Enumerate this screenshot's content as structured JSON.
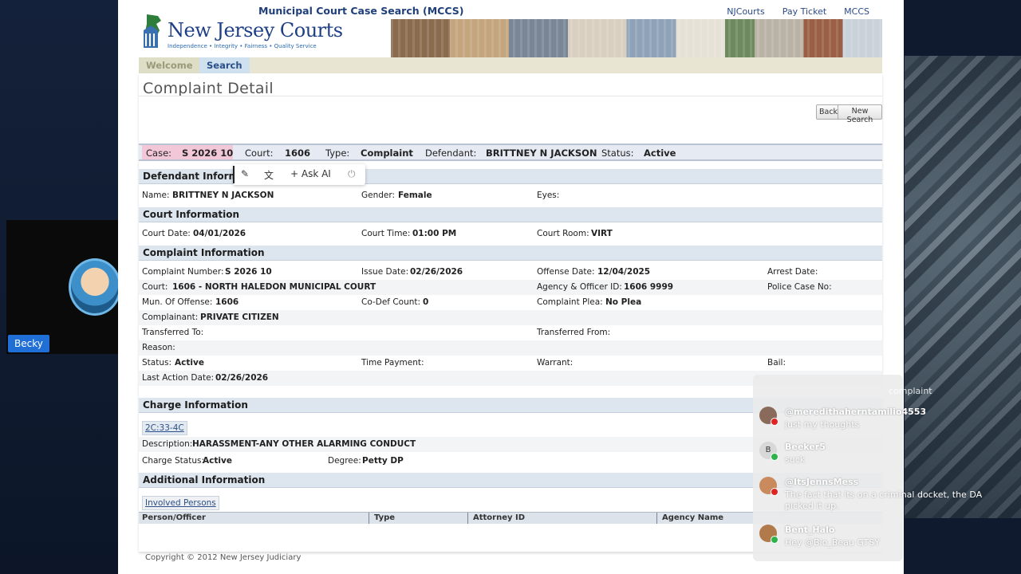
{
  "overlay": {
    "presenter_name": "Becky"
  },
  "header": {
    "title": "Municipal Court Case Search (MCCS)",
    "links": [
      "NJCourts",
      "Pay Ticket",
      "MCCS"
    ],
    "logo_text": "New Jersey Courts",
    "logo_tagline": "Independence • Integrity • Fairness • Quality Service"
  },
  "nav": {
    "welcome": "Welcome",
    "search": "Search"
  },
  "page": {
    "title": "Complaint Detail",
    "back_button": "Back",
    "new_search_button": "New Search"
  },
  "case_bar": {
    "case_label": "Case:",
    "case_value": "S 2026 10",
    "court_label": "Court:",
    "court_value": "1606",
    "type_label": "Type:",
    "type_value": "Complaint",
    "defendant_label": "Defendant:",
    "defendant_value": "BRITTNEY N JACKSON",
    "status_label": "Status:",
    "status_value": "Active"
  },
  "ai_toolbar": {
    "ask_ai": "Ask AI"
  },
  "defendant": {
    "heading": "Defendant Informa",
    "name_label": "Name:",
    "name_value": "BRITTNEY N JACKSON",
    "gender_label": "Gender:",
    "gender_value": "Female",
    "eyes_label": "Eyes:"
  },
  "court": {
    "heading": "Court Information",
    "date_label": "Court Date:",
    "date_value": "04/01/2026",
    "time_label": "Court Time:",
    "time_value": "01:00 PM",
    "room_label": "Court Room:",
    "room_value": "VIRT"
  },
  "complaint": {
    "heading": "Complaint Information",
    "number_label": "Complaint Number:",
    "number_value": "S 2026 10",
    "issue_label": "Issue Date:",
    "issue_value": "02/26/2026",
    "offense_label": "Offense Date:",
    "offense_value": "12/04/2025",
    "arrest_label": "Arrest Date:",
    "court_label": "Court:",
    "court_value": "1606 - NORTH HALEDON MUNICIPAL COURT",
    "agency_label": "Agency & Officer ID:",
    "agency_value": "1606 9999",
    "police_label": "Police Case No:",
    "mun_label": "Mun. Of Offense:",
    "mun_value": "1606",
    "codef_label": "Co-Def Count:",
    "codef_value": "0",
    "plea_label": "Complaint Plea:",
    "plea_value": "No Plea",
    "complainant_label": "Complainant:",
    "complainant_value": "PRIVATE CITIZEN",
    "transferred_to_label": "Transferred To:",
    "transferred_from_label": "Transferred From:",
    "reason_label": "Reason:",
    "status_label": "Status:",
    "status_value": "Active",
    "time_payment_label": "Time Payment:",
    "warrant_label": "Warrant:",
    "bail_label": "Bail:",
    "last_action_label": "Last Action Date:",
    "last_action_value": "02/26/2026"
  },
  "charge": {
    "heading": "Charge Information",
    "statute": "2C:33-4C",
    "description_label": "Description:",
    "description_value": "HARASSMENT-ANY OTHER ALARMING CONDUCT",
    "status_label": "Charge Status:",
    "status_value": "Active",
    "degree_label": "Degree:",
    "degree_value": "Petty DP"
  },
  "additional": {
    "heading": "Additional Information",
    "involved_button": "Involved Persons",
    "columns": [
      "Person/Officer",
      "Type",
      "Attorney ID",
      "Agency Name"
    ]
  },
  "footer": {
    "copyright": "Copyright © 2012 New Jersey Judiciary"
  },
  "chat": {
    "faded_word": "complaint",
    "messages": [
      {
        "name": "@meredithaherntamilio4553",
        "text": "just my thoughts",
        "avatar_color": "#8a6a5a",
        "badge_color": "#e02424"
      },
      {
        "name": "Beeker5",
        "text": "suck",
        "avatar_color": "#d8d8d8",
        "badge_color": "#2db34a",
        "avatar_letter": "B"
      },
      {
        "name": "@ItsJennsMess",
        "text": "The fact that its on a criminal docket, the DA picked it up.",
        "avatar_color": "#c98a5e",
        "badge_color": "#e02424"
      },
      {
        "name": "Bent_Halo",
        "text": "Hey @Bio_Beau GTSY",
        "avatar_color": "#b07a4a",
        "badge_color": "#2db34a"
      }
    ]
  }
}
